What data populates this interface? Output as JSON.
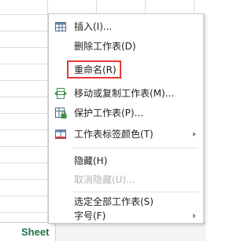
{
  "sheet_tab": {
    "label": "Sheet"
  },
  "context_menu": {
    "items": [
      {
        "label": "插入(I)...",
        "icon": "insert-table-icon"
      },
      {
        "label": "删除工作表(D)"
      },
      {
        "label": "重命名(R)",
        "highlighted": true
      },
      {
        "label": "移动或复制工作表(M)...",
        "icon": "move-copy-sheet-icon"
      },
      {
        "label": "保护工作表(P)...",
        "icon": "protect-sheet-icon"
      },
      {
        "label": "工作表标签颜色(T)",
        "icon": "tab-color-icon",
        "submenu": true
      },
      {
        "label": "隐藏(H)"
      },
      {
        "label": "取消隐藏(U)...",
        "disabled": true
      },
      {
        "label": "选定全部工作表(S)"
      },
      {
        "label": "字号(F)",
        "submenu": true
      }
    ]
  },
  "colors": {
    "highlight_border": "#e53935",
    "sheet_tab_text": "#217346",
    "disabled_text": "#b4b4b4"
  }
}
